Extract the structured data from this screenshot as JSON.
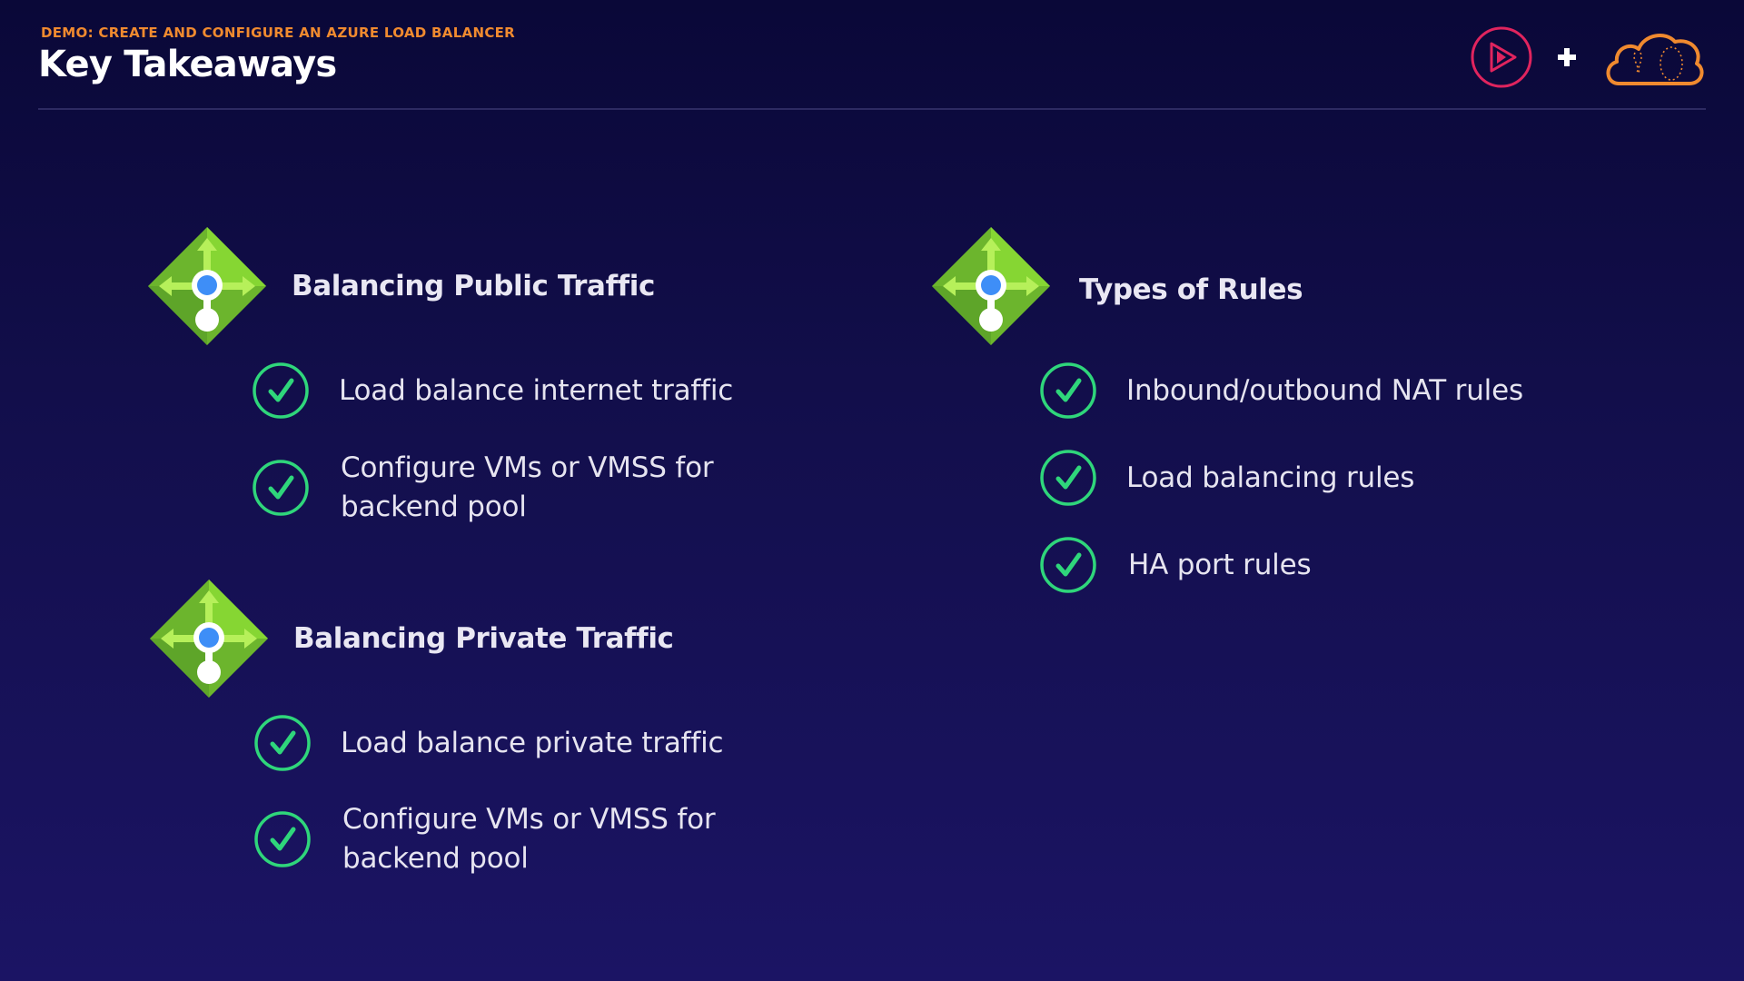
{
  "header": {
    "eyebrow": "DEMO: CREATE AND CONFIGURE AN AZURE LOAD BALANCER",
    "title": "Key Takeaways"
  },
  "logos": [
    {
      "name": "play-logo-icon",
      "color": "#e0245e"
    },
    {
      "name": "plus-icon",
      "color": "#ffffff"
    },
    {
      "name": "cloud-logo-icon",
      "color": "#f08a2f"
    }
  ],
  "sections": {
    "public": {
      "title": "Balancing Public Traffic",
      "items": [
        "Load balance internet traffic",
        "Configure VMs or VMSS for backend pool"
      ]
    },
    "private": {
      "title": "Balancing Private Traffic",
      "items": [
        "Load balance private traffic",
        "Configure VMs or VMSS for backend pool"
      ]
    },
    "rules": {
      "title": "Types of Rules",
      "items": [
        "Inbound/outbound NAT rules",
        "Load balancing rules",
        "HA port rules"
      ]
    }
  },
  "colors": {
    "accent_orange": "#f08a2f",
    "check_green": "#2fd67b",
    "icon_green_light": "#86d633",
    "icon_green_dark": "#5ea529",
    "icon_blue": "#3e8ef7"
  }
}
